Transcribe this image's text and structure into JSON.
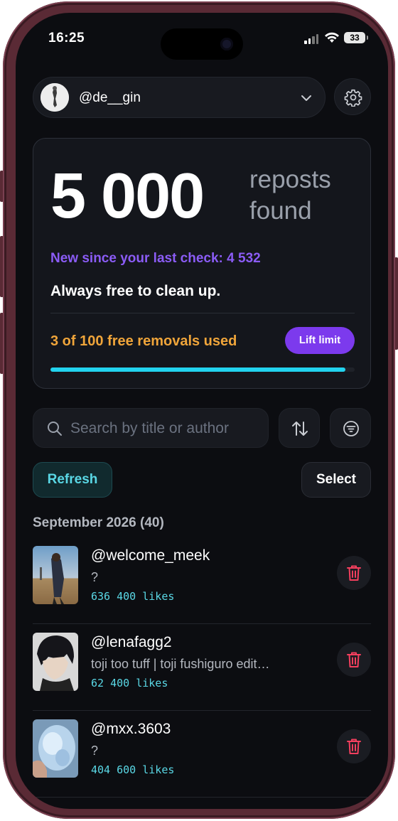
{
  "status_bar": {
    "time": "16:25",
    "battery": "33"
  },
  "account": {
    "handle": "@de__gin"
  },
  "summary": {
    "count": "5 000",
    "unit": "reposts found",
    "new_since": "New since your last check: 4 532",
    "free_text": "Always free to clean up.",
    "used_text": "3 of 100 free removals used",
    "lift_button": "Lift limit",
    "progress_fraction": 0.97
  },
  "search": {
    "placeholder": "Search by title or author",
    "value": ""
  },
  "actions": {
    "refresh": "Refresh",
    "select": "Select"
  },
  "section": {
    "title": "September 2026 (40)"
  },
  "reposts": [
    {
      "author": "@welcome_meek",
      "title": "?",
      "likes": "636 400 likes"
    },
    {
      "author": "@lenafagg2",
      "title": "toji too tuff | toji fushiguro edit…",
      "likes": "62 400 likes"
    },
    {
      "author": "@mxx.3603",
      "title": "?",
      "likes": "404 600 likes"
    }
  ],
  "colors": {
    "accent_purple": "#7c3aed",
    "new_text": "#8b5cf6",
    "usage_orange": "#f0a53a",
    "cyan": "#22d3ee",
    "delete_red": "#f43f5e"
  }
}
